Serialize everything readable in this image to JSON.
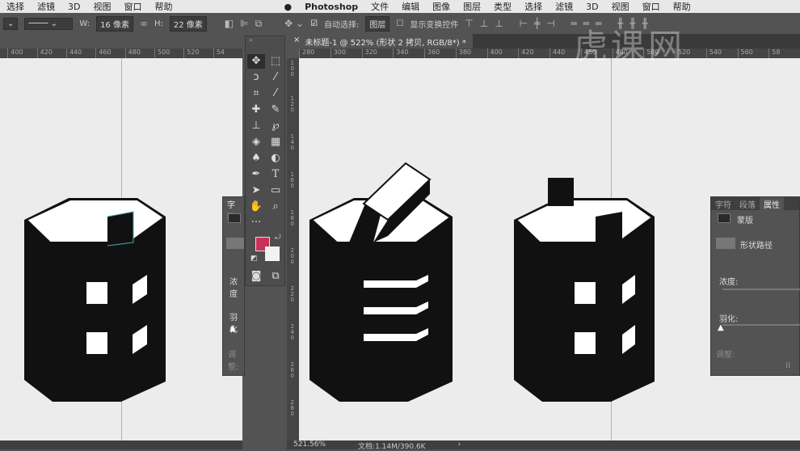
{
  "menubar": {
    "left_items": [
      "选择",
      "滤镜",
      "3D",
      "视图",
      "窗口",
      "帮助"
    ],
    "app": "Photoshop",
    "right_items": [
      "文件",
      "编辑",
      "图像",
      "图层",
      "类型",
      "选择",
      "滤镜",
      "3D",
      "视图",
      "窗口",
      "帮助"
    ]
  },
  "options": {
    "w_label": "W:",
    "w_value": "16 像素",
    "h_label": "H:",
    "h_value": "22 像素",
    "auto_select_label": "自动选择:",
    "auto_select_value": "图层",
    "auto_select_checked": true,
    "show_transform_label": "显示变换控件",
    "show_transform_checked": false
  },
  "document": {
    "tab_title": "未标题-1 @ 522% (形状 2 拷贝, RGB/8*) *",
    "zoom": "521.56%",
    "doc_info": "文档:1.14M/390.6K"
  },
  "rulers": {
    "left_h": [
      "400",
      "420",
      "440",
      "460",
      "480",
      "500",
      "520",
      "54"
    ],
    "right_h": [
      "280",
      "300",
      "320",
      "340",
      "360",
      "380",
      "400",
      "420",
      "440",
      "460",
      "480",
      "500",
      "520",
      "540",
      "560",
      "58"
    ],
    "right_v": [
      "100",
      "120",
      "140",
      "160",
      "180",
      "200",
      "220",
      "240",
      "260",
      "280"
    ]
  },
  "colors": {
    "foreground": "#c8325a",
    "background": "#f2f2f2",
    "guide": "#5fd6c8"
  },
  "left_panel": {
    "tab": "字符",
    "density": "浓度",
    "feather": "羽化",
    "adjust": "调整:"
  },
  "properties_panel": {
    "tabs": [
      "字符",
      "段落",
      "属性"
    ],
    "active_tab": "属性",
    "mask": "蒙版",
    "shape_path": "形状路径",
    "density": "浓度:",
    "feather": "羽化:",
    "adjust": "调整:"
  },
  "watermark": "虎课网"
}
